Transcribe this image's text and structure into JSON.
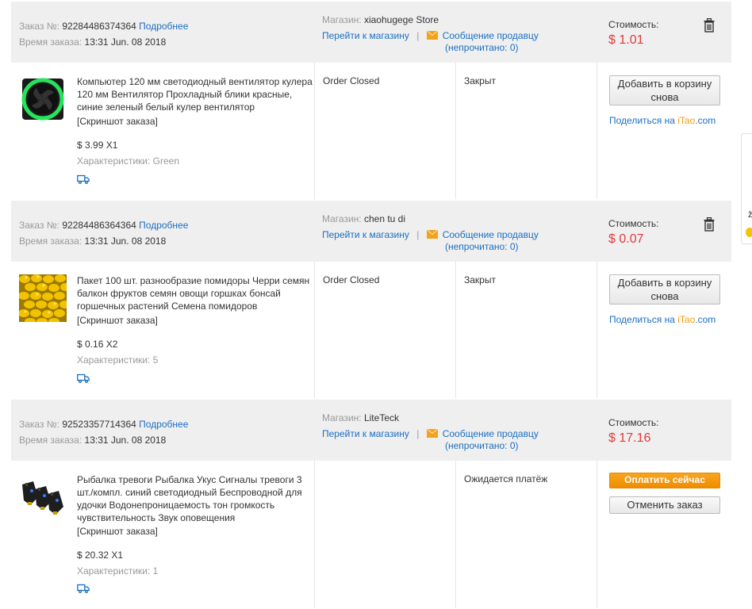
{
  "labels": {
    "order_no": "Заказ №:",
    "details_link": "Подробнее",
    "order_time": "Время заказа:",
    "store": "Магазин:",
    "go_to_store": "Перейти к магазину",
    "separator": "|",
    "message_seller": "Сообщение продавцу",
    "unread": "(непрочитано: 0)",
    "cost": "Стоимость:",
    "snapshot": "[Скриншот заказа]",
    "characteristics": "Характеристики:",
    "share_prefix": "Поделиться на ",
    "share_brand": "iTao",
    "share_suffix": ".com"
  },
  "orders": [
    {
      "order_number": "92284486374364",
      "order_time": "13:31 Jun. 08 2018",
      "store_name": "xiaohugege Store",
      "cost": "$ 1.01",
      "product_title": "Компьютер 120 мм светодиодный вентилятор кулера 120 мм Вентилятор Прохладный блики красные, синие зеленый белый кулер вентилятор",
      "price_qty": "$ 3.99 X1",
      "characteristics_value": "Green",
      "status_en": "Order Closed",
      "status_ru": "Закрыт",
      "action_label": "Добавить в корзину снова",
      "thumb_icon": "green-led-fan"
    },
    {
      "order_number": "92284486364364",
      "order_time": "13:31 Jun. 08 2018",
      "store_name": "chen tu di",
      "cost": "$ 0.07",
      "product_title": "Пакет 100 шт. разнообразие помидоры Черри семян балкон фруктов семян овощи горшках бонсай горшечных растений Семена помидоров",
      "price_qty": "$ 0.16 X2",
      "characteristics_value": "5",
      "status_en": "Order Closed",
      "status_ru": "Закрыт",
      "action_label": "Добавить в корзину снова",
      "thumb_icon": "yellow-cherry-tomatoes"
    },
    {
      "order_number": "92523357714364",
      "order_time": "13:31 Jun. 08 2018",
      "store_name": "LiteTeck",
      "cost": "$ 17.16",
      "product_title": "Рыбалка тревоги Рыбалка Укус Сигналы тревоги 3 шт./компл. синий светодиодный Беспроводной для удочки Водонепроницаемость тон громкость чувствительность Звук оповещения",
      "price_qty": "$ 20.32 X1",
      "characteristics_value": "1",
      "status_en": "",
      "status_ru": "Ожидается платёж",
      "pay_label": "Оплатить сейчас",
      "cancel_label": "Отменить заказ",
      "thumb_icon": "fishing-bite-alarms"
    }
  ],
  "colors": {
    "link": "#1a6ec2",
    "price": "#e4393c",
    "accent": "#f39c12",
    "header_bg": "#efefef"
  }
}
